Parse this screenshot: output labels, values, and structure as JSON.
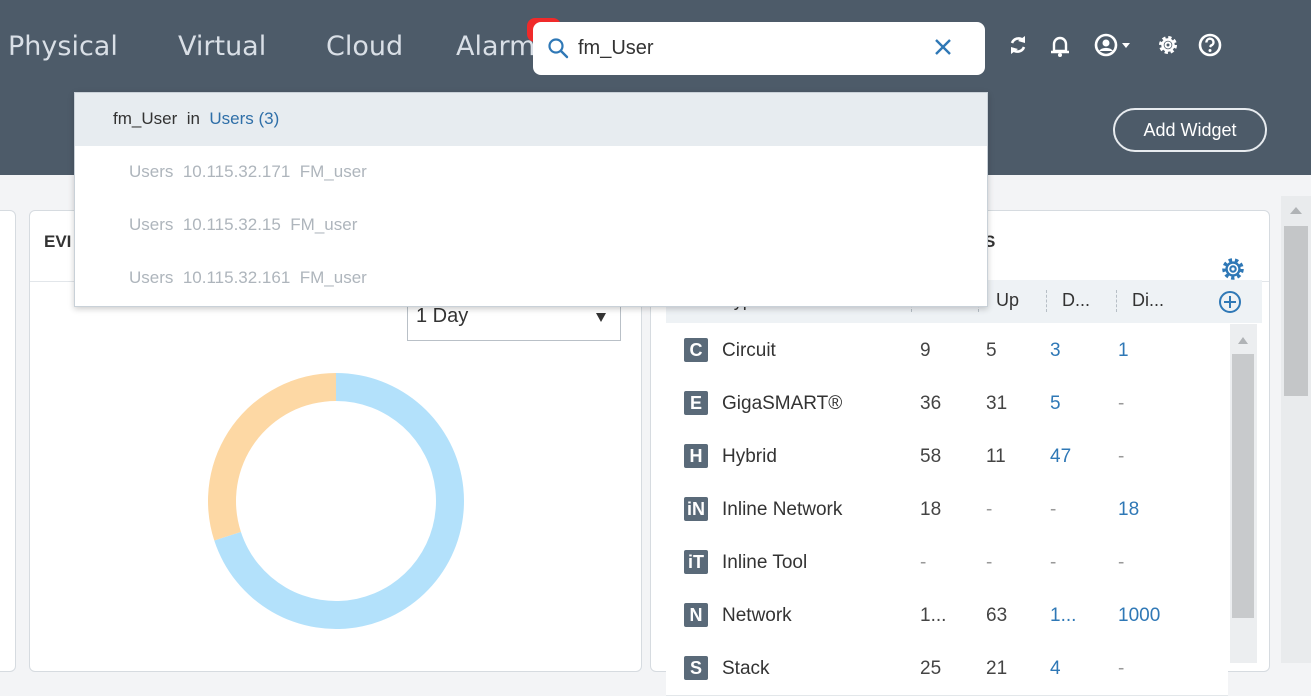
{
  "nav": {
    "tabs": [
      "Physical",
      "Virtual",
      "Cloud",
      "Alarm"
    ]
  },
  "search": {
    "value": "fm_User"
  },
  "header": {
    "add_widget_label": "Add Widget"
  },
  "dropdown": {
    "first": {
      "query": "fm_User",
      "in_label": "in",
      "category": "Users (3)"
    },
    "results": [
      "Users  10.115.32.171  FM_user",
      "Users  10.115.32.15  FM_user",
      "Users  10.115.32.161  FM_user"
    ]
  },
  "left_panel": {
    "title_fragment": "EVI",
    "time_select": "1 Day",
    "donut": {
      "segments": [
        {
          "share": 0.7,
          "color": "#b3e1fb"
        },
        {
          "share": 0.3,
          "color": "#fdd8a4"
        }
      ]
    }
  },
  "right_panel": {
    "title_fragment": "S",
    "columns": [
      "Port Type",
      "T...",
      "Up",
      "D...",
      "Di..."
    ],
    "rows": [
      {
        "letter": "C",
        "name": "Circuit",
        "total": "9",
        "up": "5",
        "down": "3",
        "disabled": "1"
      },
      {
        "letter": "E",
        "name": "GigaSMART®",
        "total": "36",
        "up": "31",
        "down": "5",
        "disabled": "-"
      },
      {
        "letter": "H",
        "name": "Hybrid",
        "total": "58",
        "up": "11",
        "down": "47",
        "disabled": "-"
      },
      {
        "letter": "iN",
        "name": "Inline Network",
        "total": "18",
        "up": "-",
        "down": "-",
        "disabled": "18"
      },
      {
        "letter": "iT",
        "name": "Inline Tool",
        "total": "-",
        "up": "-",
        "down": "-",
        "disabled": "-"
      },
      {
        "letter": "N",
        "name": "Network",
        "total": "1...",
        "up": "63",
        "down": "1...",
        "disabled": "1000"
      },
      {
        "letter": "S",
        "name": "Stack",
        "total": "25",
        "up": "21",
        "down": "4",
        "disabled": "-"
      }
    ]
  },
  "colors": {
    "topbar": "#4d5b69",
    "link": "#2f78b6",
    "alarm_badge": "#f02a2a"
  }
}
